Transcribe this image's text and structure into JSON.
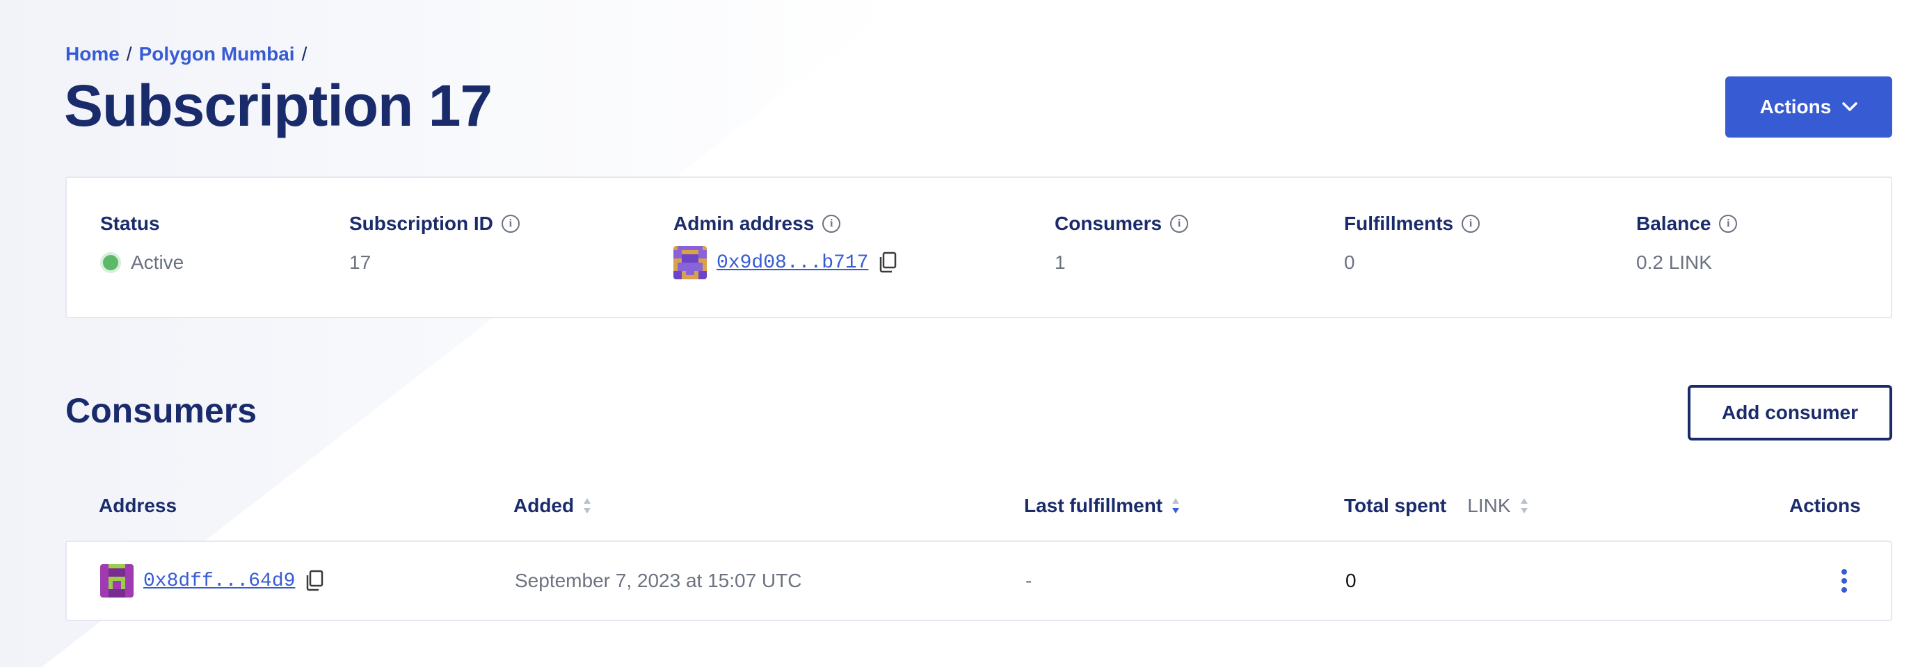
{
  "breadcrumb": {
    "home": "Home",
    "network": "Polygon Mumbai",
    "sep": "/"
  },
  "page_title": "Subscription 17",
  "header_actions_label": "Actions",
  "details": {
    "status": {
      "label": "Status",
      "value": "Active"
    },
    "subscription_id": {
      "label": "Subscription ID",
      "value": "17"
    },
    "admin_address": {
      "label": "Admin address",
      "value": "0x9d08...b717"
    },
    "consumers": {
      "label": "Consumers",
      "value": "1"
    },
    "fulfillments": {
      "label": "Fulfillments",
      "value": "0"
    },
    "balance": {
      "label": "Balance",
      "value": "0.2 LINK"
    }
  },
  "consumers_section": {
    "title": "Consumers",
    "add_button": "Add consumer",
    "columns": {
      "address": "Address",
      "added": "Added",
      "last_fulfillment": "Last fulfillment",
      "total_spent": "Total spent",
      "total_spent_unit": "LINK",
      "actions": "Actions"
    },
    "rows": [
      {
        "address": "0x8dff...64d9",
        "added": "September 7, 2023 at 15:07 UTC",
        "last_fulfillment": "-",
        "total_spent": "0"
      }
    ]
  },
  "colors": {
    "accent": "#375bd2",
    "text_dark": "#1a2b6b",
    "text_muted": "#6b7280",
    "status_active": "#5cb96a"
  },
  "icons": [
    "info-icon",
    "copy-icon",
    "chevron-down-icon",
    "sort-icon",
    "kebab-menu-icon",
    "blockie-avatar"
  ]
}
